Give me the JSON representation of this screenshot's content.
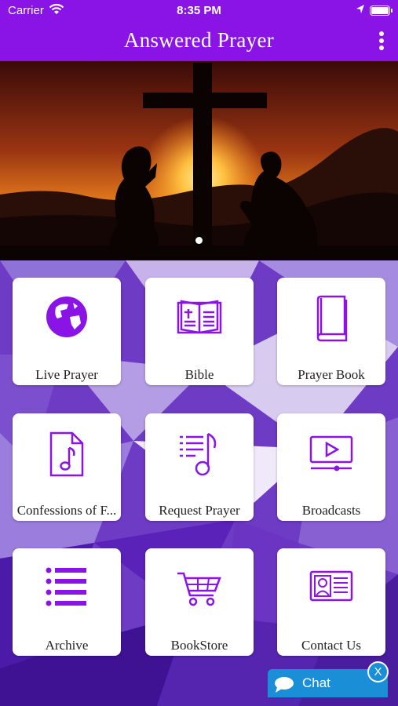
{
  "status_bar": {
    "carrier": "Carrier",
    "time": "8:35 PM"
  },
  "header": {
    "title": "Answered Prayer"
  },
  "colors": {
    "accent": "#8a14e6",
    "chat": "#1a8fd8"
  },
  "carousel": {
    "page_count": 1,
    "active_page": 1
  },
  "tiles": [
    {
      "label": "Live Prayer",
      "icon": "globe-icon"
    },
    {
      "label": "Bible",
      "icon": "open-book-icon"
    },
    {
      "label": "Prayer Book",
      "icon": "book-icon"
    },
    {
      "label": "Confessions of F...",
      "icon": "music-file-icon"
    },
    {
      "label": "Request Prayer",
      "icon": "playlist-icon"
    },
    {
      "label": "Broadcasts",
      "icon": "video-player-icon"
    },
    {
      "label": "Archive",
      "icon": "list-icon"
    },
    {
      "label": "BookStore",
      "icon": "shopping-cart-icon"
    },
    {
      "label": "Contact Us",
      "icon": "contact-card-icon"
    }
  ],
  "chat": {
    "label": "Chat",
    "close": "X"
  }
}
